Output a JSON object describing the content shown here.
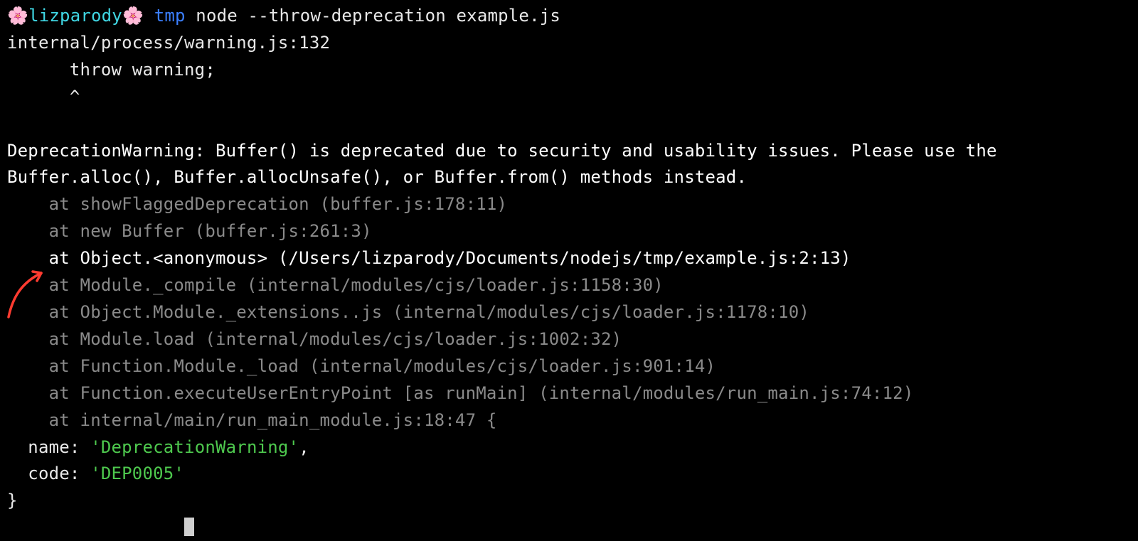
{
  "prompt": {
    "flower": "🌸",
    "user": "lizparody",
    "cwd": "tmp",
    "command": "node --throw-deprecation example.js"
  },
  "output": {
    "file_ref": "internal/process/warning.js:132",
    "throw_line": "      throw warning;",
    "throw_caret": "      ^",
    "warning_l1": "DeprecationWarning: Buffer() is deprecated due to security and usability issues. Please use the",
    "warning_l2": "Buffer.alloc(), Buffer.allocUnsafe(), or Buffer.from() methods instead."
  },
  "stack": [
    "    at showFlaggedDeprecation (buffer.js:178:11)",
    "    at new Buffer (buffer.js:261:3)",
    "    at Object.<anonymous> (/Users/lizparody/Documents/nodejs/tmp/example.js:2:13)",
    "    at Module._compile (internal/modules/cjs/loader.js:1158:30)",
    "    at Object.Module._extensions..js (internal/modules/cjs/loader.js:1178:10)",
    "    at Module.load (internal/modules/cjs/loader.js:1002:32)",
    "    at Function.Module._load (internal/modules/cjs/loader.js:901:14)",
    "    at Function.executeUserEntryPoint [as runMain] (internal/modules/run_main.js:74:12)"
  ],
  "stack_tail": "    at internal/main/run_main_module.js:18:47 {",
  "obj": {
    "name_key": "  name: ",
    "name_val": "'DeprecationWarning'",
    "comma": ",",
    "code_key": "  code: ",
    "code_val": "'DEP0005'",
    "close": "}"
  },
  "highlight_index": 2,
  "colors": {
    "cyan": "#40d7e4",
    "blue": "#3b7fff",
    "white": "#e8e8e8",
    "dim": "#8a8a8a",
    "green": "#4ec94e",
    "arrow": "#ff3b30"
  }
}
